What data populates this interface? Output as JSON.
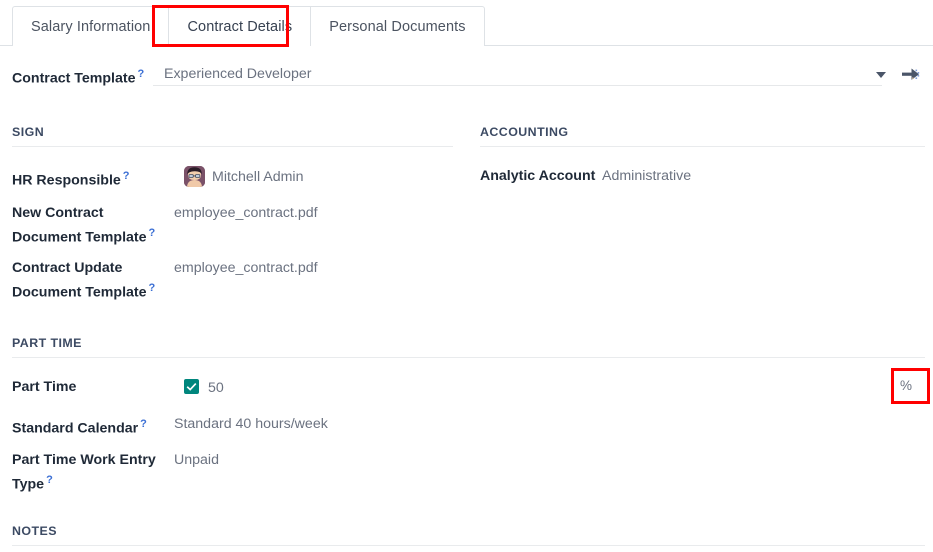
{
  "tabs": [
    {
      "label": "Salary Information",
      "active": false
    },
    {
      "label": "Contract Details",
      "active": true
    },
    {
      "label": "Personal Documents",
      "active": false
    }
  ],
  "contract_template": {
    "label": "Contract Template",
    "tooltip_marker": "?",
    "value": "Experienced Developer",
    "caret_icon": "chevron-down-icon",
    "internal_link_icon": "arrow-right-icon"
  },
  "sections": {
    "sign": {
      "title": "SIGN",
      "fields": [
        {
          "label": "HR Responsible",
          "tooltip_marker": "?",
          "value": "Mitchell Admin",
          "avatar": "user-avatar"
        },
        {
          "label": "New Contract Document Template",
          "tooltip_marker": "?",
          "value": "employee_contract.pdf"
        },
        {
          "label": "Contract Update Document Template",
          "tooltip_marker": "?",
          "value": "employee_contract.pdf"
        }
      ]
    },
    "accounting": {
      "title": "ACCOUNTING",
      "fields": [
        {
          "label": "Analytic Account",
          "value": "Administrative"
        }
      ]
    },
    "part_time": {
      "title": "PART TIME",
      "fields": [
        {
          "label": "Part Time",
          "checked": true,
          "value": "50",
          "suffix": "%"
        },
        {
          "label": "Standard Calendar",
          "tooltip_marker": "?",
          "value": "Standard 40 hours/week"
        },
        {
          "label": "Part Time Work Entry Type",
          "tooltip_marker": "?",
          "value": "Unpaid"
        }
      ]
    },
    "notes": {
      "title": "NOTES"
    }
  },
  "labels": {
    "new_contract_line1": "New Contract",
    "new_contract_line2": "Document Template",
    "contract_update_line1": "Contract Update",
    "contract_update_line2": "Document Template",
    "ptwe_line1": "Part Time Work Entry",
    "ptwe_line2": "Type"
  },
  "colors": {
    "accent_teal": "#00867d",
    "tooltip_blue": "#3b6fd4",
    "annotation_red": "#ff0000",
    "section_header": "#3c4a63"
  }
}
